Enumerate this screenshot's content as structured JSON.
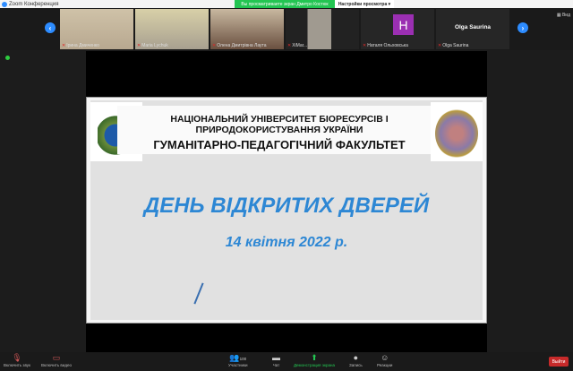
{
  "window": {
    "title": "Zoom Конференция"
  },
  "banner": {
    "share_text": "Вы просматриваете экран Дмитро Костюк",
    "view_options": "Настройки просмотра ▾"
  },
  "participants": [
    {
      "name": "Ірина Дмиченко"
    },
    {
      "name": "Maria Lychuk"
    },
    {
      "name": "Олена Дмитрівна Лаута"
    },
    {
      "name": "XiMar..."
    },
    {
      "name": "Наталя Ольховська",
      "avatar_letter": "H"
    },
    {
      "name": "Olga Saurina",
      "display": "Olga Saurina"
    }
  ],
  "view_label": "Вид",
  "slide": {
    "line1": "НАЦІОНАЛЬНИЙ УНІВЕРСИТЕТ БІОРЕСУРСІВ І",
    "line2": "ПРИРОДОКОРИСТУВАННЯ УКРАЇНИ",
    "line3": "ГУМАНІТАРНО-ПЕДАГОГІЧНИЙ ФАКУЛЬТЕТ",
    "title": "ДЕНЬ ВІДКРИТИХ ДВЕРЕЙ",
    "date": "14 квітня 2022 р."
  },
  "toolbar": {
    "unmute": "Включить звук",
    "video": "Включить видео",
    "participants": "Участники",
    "participants_count": "100",
    "chat": "Чат",
    "share": "Демонстрация экрана",
    "record": "Запись",
    "reactions": "Реакции",
    "leave": "Выйти"
  },
  "colors": {
    "accent": "#2d8cff",
    "share_green": "#23c552",
    "leave_red": "#c72a2a",
    "slide_blue": "#2d87d4"
  }
}
